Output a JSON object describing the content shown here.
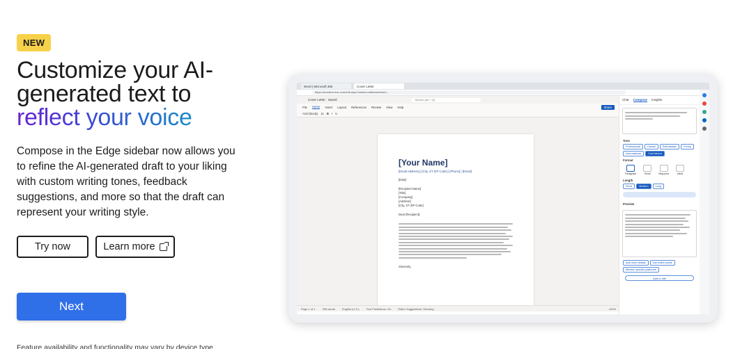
{
  "badge": "NEW",
  "headline": {
    "line1": "Customize your AI-",
    "line2": "generated text to",
    "line3": "reflect your voice"
  },
  "body": "Compose in the Edge sidebar now allows you to refine the AI-generated draft to your liking with custom writing tones, feedback suggestions, and more so that the draft can represent your writing style.",
  "buttons": {
    "try_now": "Try now",
    "learn_more": "Learn more",
    "next": "Next"
  },
  "footnote": "Feature availability and functionality may vary by device type",
  "colors": {
    "badge": "#f8d14a",
    "primary": "#2f6fe8",
    "gradient_start": "#6a1fd1",
    "gradient_end": "#1a8bc7"
  },
  "screen": {
    "tabs": [
      "Word | Microsoft 365",
      "Cover Letter"
    ],
    "url": "https://onedrive.live.com/edit.aspx?action=editnew&resid=...",
    "doc_title": "Cover Letter · Saved",
    "search": "Search (Alt + Q)",
    "ribbon_tabs": [
      "File",
      "Home",
      "Insert",
      "Layout",
      "References",
      "Review",
      "View",
      "Help"
    ],
    "share": "Share",
    "toolbar_items": [
      "Arial (Body)",
      "11",
      "B",
      "I",
      "U"
    ],
    "letter": {
      "name": "[Your Name]",
      "contact": "[Email Address] | [City, ST ZIP Code] | [Phone] | [Email]",
      "date": "[Date]",
      "recipient": [
        "[Recipient Name]",
        "[Title]",
        "[Company]",
        "[Address]",
        "[City, ST ZIP Code]"
      ],
      "greeting": "Dear [Recipient]:",
      "closing": "Sincerely,"
    },
    "status": [
      "Page 1 of 1",
      "335 words",
      "English (U.S.)",
      "Text Predictions: On",
      "Editor Suggestions: Showing"
    ],
    "zoom": "100%",
    "sidebar": {
      "tabs": [
        "Chat",
        "Compose",
        "Insights"
      ],
      "tone_label": "Tone",
      "tones": [
        "Professional",
        "Casual",
        "Enthusiastic",
        "Funny",
        "Informational",
        "Conf idence"
      ],
      "format_label": "Format",
      "formats": [
        "Paragraph",
        "Email",
        "Blog post",
        "Ideas"
      ],
      "length_label": "Length",
      "lengths": [
        "Short",
        "Medium",
        "Long"
      ],
      "preview_label": "Preview",
      "actions": [
        "Add more details",
        "Use bullet points",
        "Mention specific platforms"
      ],
      "add_to_site": "Add to site"
    }
  }
}
